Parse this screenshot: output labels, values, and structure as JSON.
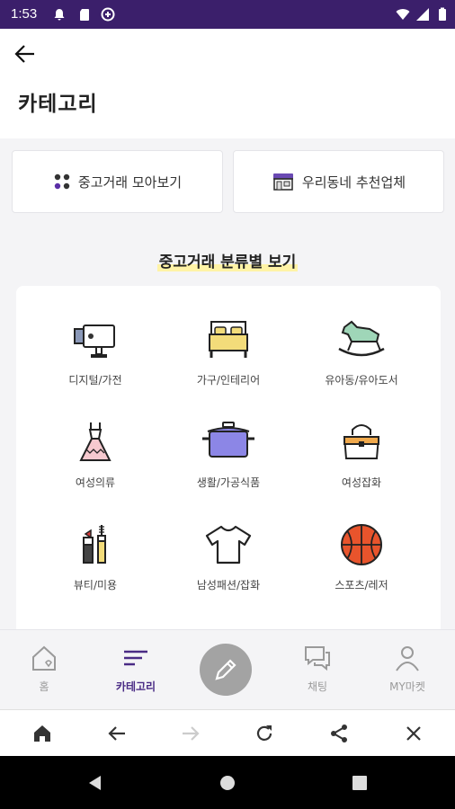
{
  "status_bar": {
    "time": "1:53"
  },
  "header": {
    "title": "카테고리"
  },
  "top_buttons": [
    {
      "label": "중고거래 모아보기",
      "icon": "grid-dots-icon"
    },
    {
      "label": "우리동네 추천업체",
      "icon": "shop-icon"
    }
  ],
  "section": {
    "title": "중고거래 분류별 보기"
  },
  "categories": [
    {
      "label": "디지털/가전",
      "icon": "camera-icon"
    },
    {
      "label": "가구/인테리어",
      "icon": "bed-icon"
    },
    {
      "label": "유아동/유아도서",
      "icon": "rocking-horse-icon"
    },
    {
      "label": "여성의류",
      "icon": "dress-icon"
    },
    {
      "label": "생활/가공식품",
      "icon": "pot-icon"
    },
    {
      "label": "여성잡화",
      "icon": "handbag-icon"
    },
    {
      "label": "뷰티/미용",
      "icon": "cosmetics-icon"
    },
    {
      "label": "남성패션/잡화",
      "icon": "tshirt-icon"
    },
    {
      "label": "스포츠/레저",
      "icon": "basketball-icon"
    }
  ],
  "bottom_nav": [
    {
      "label": "홈",
      "icon": "home-icon"
    },
    {
      "label": "카테고리",
      "icon": "menu-lines-icon",
      "active": true
    },
    {
      "label": "채팅",
      "icon": "chat-icon"
    },
    {
      "label": "MY마켓",
      "icon": "person-icon"
    }
  ],
  "colors": {
    "status_bar": "#3b1f6b",
    "accent": "#4a2b85",
    "highlight": "#fff3a6",
    "fab": "#a3a3a3"
  }
}
